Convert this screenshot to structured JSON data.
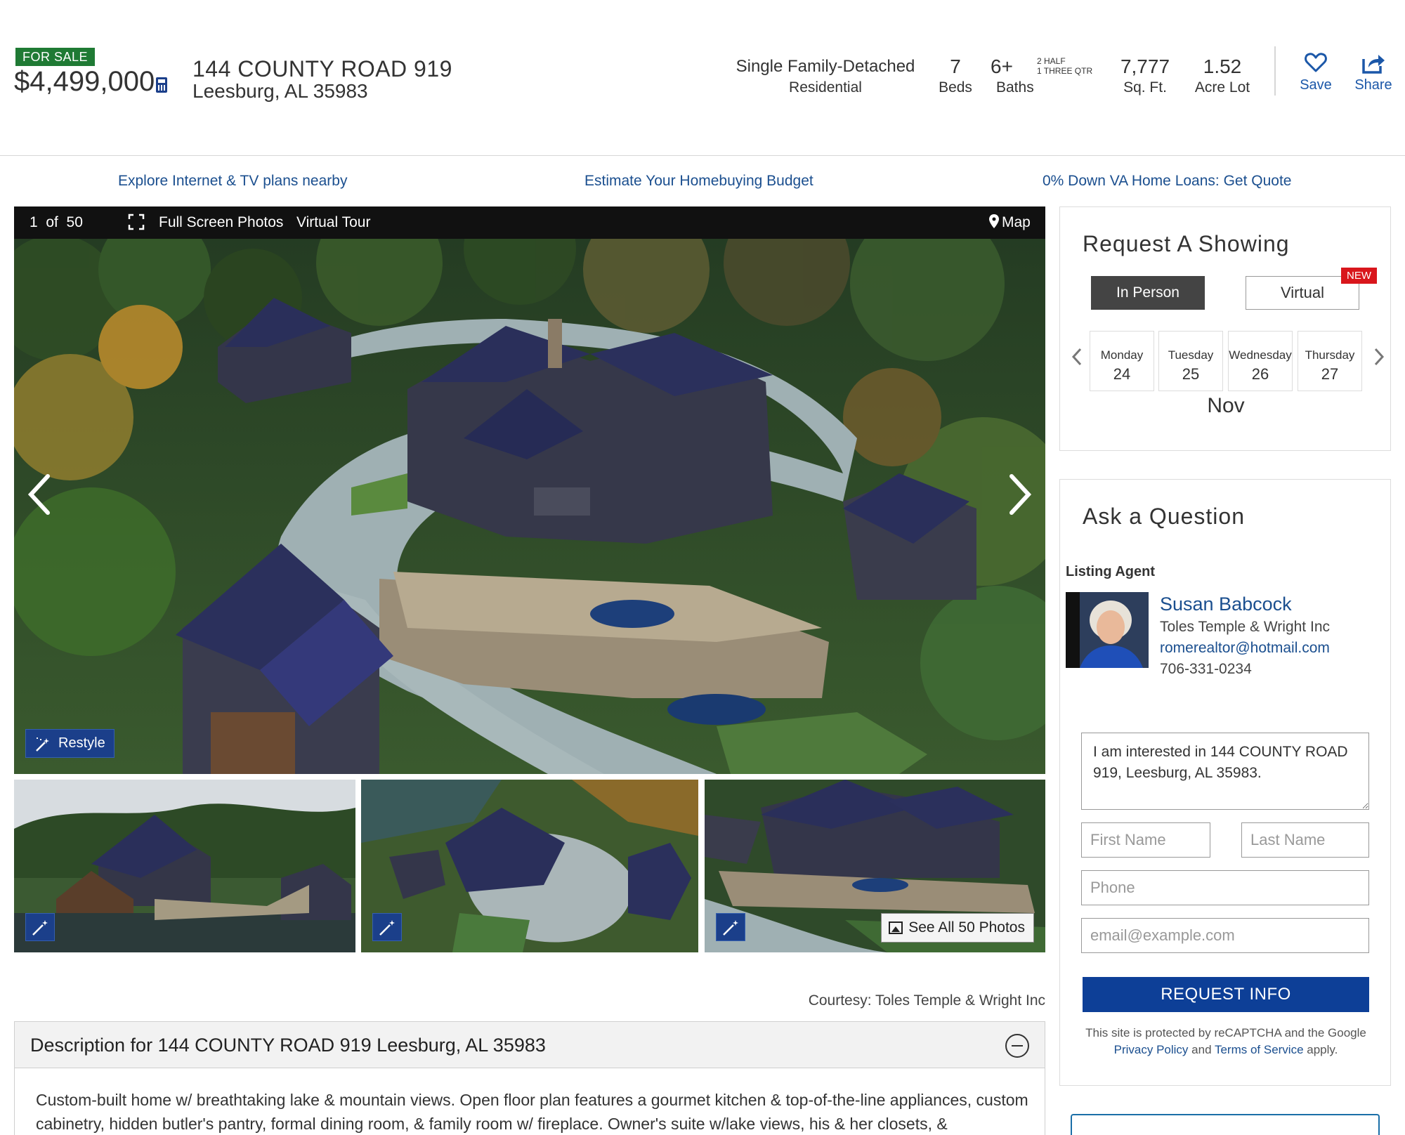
{
  "listing": {
    "status": "FOR SALE",
    "price": "$4,499,000",
    "street": "144 COUNTY ROAD 919",
    "city_state_zip": "Leesburg, AL 35983"
  },
  "stats": {
    "type": "Single Family-Detached",
    "type_sub": "Residential",
    "beds": "7",
    "beds_label": "Beds",
    "baths": "6+",
    "baths_note_1": "2 HALF",
    "baths_note_2": "1 THREE QTR",
    "baths_label": "Baths",
    "sqft": "7,777",
    "sqft_label": "Sq. Ft.",
    "lot": "1.52",
    "lot_label": "Acre Lot"
  },
  "actions": {
    "save": "Save",
    "share": "Share"
  },
  "promos": [
    "Explore Internet & TV plans nearby",
    "Estimate Your Homebuying Budget",
    "0% Down VA Home Loans: Get Quote"
  ],
  "gallery": {
    "counter": "1  of  50",
    "fullscreen": "Full Screen Photos",
    "virtual_tour": "Virtual Tour",
    "map": "Map",
    "restyle": "Restyle",
    "see_all": "See All 50 Photos",
    "courtesy": "Courtesy: Toles Temple & Wright Inc"
  },
  "description": {
    "title": "Description for 144 COUNTY ROAD 919 Leesburg, AL 35983",
    "text": "Custom-built home w/ breathtaking lake & mountain views. Open floor plan features a gourmet kitchen & top-of-the-line appliances, custom cabinetry, hidden butler's pantry, formal dining room, & family room w/ fireplace. Owner's suite w/lake views, his & her closets, &"
  },
  "showing": {
    "title": "Request A Showing",
    "in_person": "In Person",
    "virtual": "Virtual",
    "new_badge": "NEW",
    "days": [
      {
        "name": "Monday",
        "num": "24"
      },
      {
        "name": "Tuesday",
        "num": "25"
      },
      {
        "name": "Wednesday",
        "num": "26"
      },
      {
        "name": "Thursday",
        "num": "27"
      }
    ],
    "month": "Nov"
  },
  "question": {
    "title": "Ask a Question",
    "agent_label": "Listing Agent",
    "agent_name": "Susan Babcock",
    "agent_company": "Toles Temple & Wright Inc",
    "agent_email": "romerealtor@hotmail.com",
    "agent_phone": "706-331-0234",
    "message": "I am interested in 144 COUNTY ROAD 919, Leesburg, AL 35983.",
    "first_placeholder": "First Name",
    "last_placeholder": "Last Name",
    "phone_placeholder": "Phone",
    "email_placeholder": "email@example.com",
    "submit": "REQUEST INFO",
    "recaptcha_1": "This site is protected by reCAPTCHA and the Google",
    "privacy": "Privacy Policy",
    "and": " and ",
    "terms": "Terms of Service",
    "apply": " apply."
  },
  "colors": {
    "status_green": "#1f7a34",
    "brand_blue": "#0d3f97",
    "link_blue": "#1b4f8f",
    "new_red": "#d9161c"
  }
}
